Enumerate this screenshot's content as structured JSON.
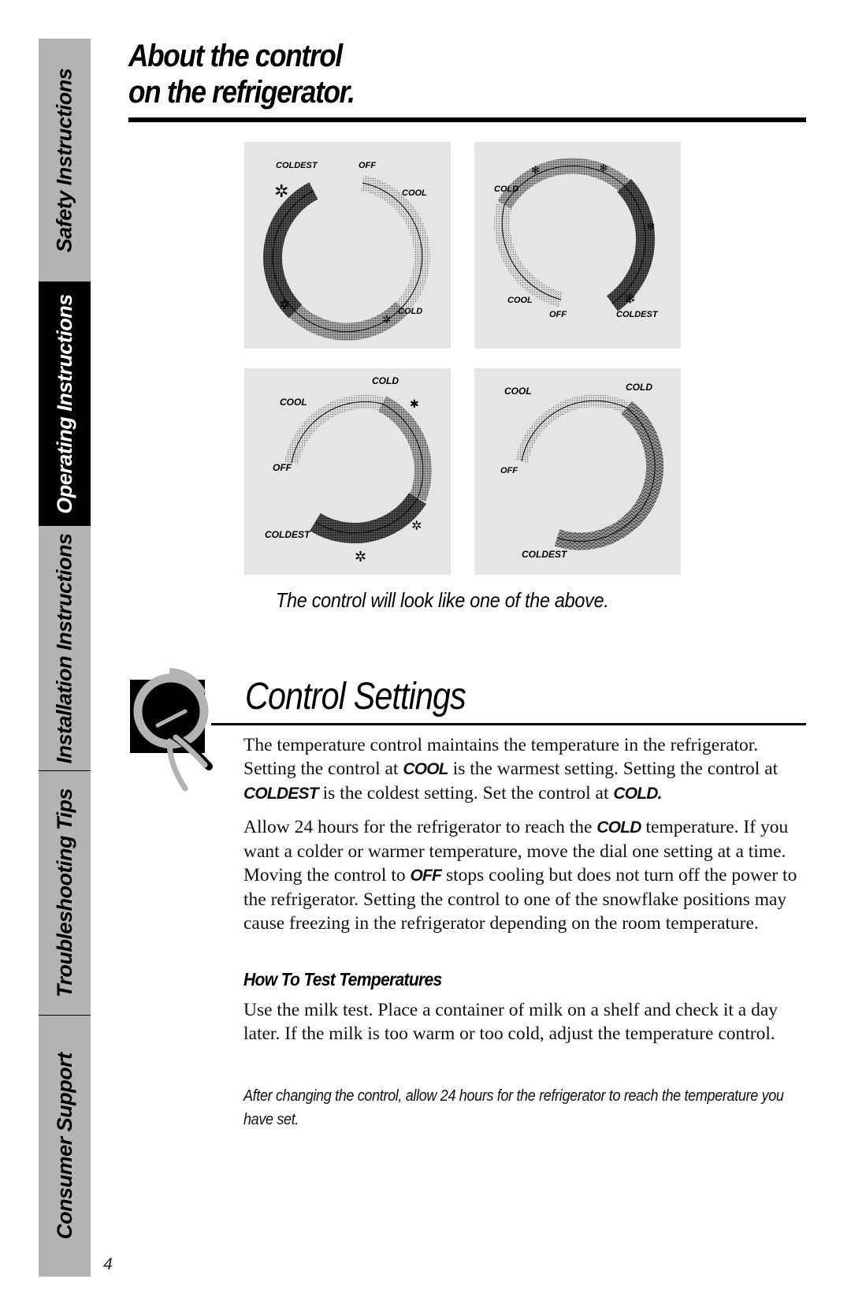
{
  "sidebar": {
    "tabs": [
      {
        "label": "Safety Instructions",
        "active": false
      },
      {
        "label": "Operating Instructions",
        "active": true
      },
      {
        "label": "Installation Instructions",
        "active": false
      },
      {
        "label": "Troubleshooting Tips",
        "active": false
      },
      {
        "label": "Consumer Support",
        "active": false
      }
    ]
  },
  "page_number": "4",
  "header": {
    "title_line1": "About the control",
    "title_line2": "on the refrigerator."
  },
  "dials": [
    {
      "labels": {
        "coldest": "COLDEST",
        "off": "OFF",
        "cool": "COOL",
        "cold": "COLD"
      },
      "icons": [
        "snowflake-icon",
        "snowflake-icon",
        "snowflake-icon"
      ]
    },
    {
      "labels": {
        "cold": "COLD",
        "cool": "COOL",
        "off": "OFF",
        "coldest": "COLDEST"
      },
      "icons": [
        "snowflake-icon",
        "snowflake-icon",
        "snowflake-icon",
        "snowflake-icon"
      ]
    },
    {
      "labels": {
        "cold": "COLD",
        "cool": "COOL",
        "off": "OFF",
        "coldest": "COLDEST"
      },
      "icons": [
        "snowflake-icon",
        "snowflake-icon",
        "snowflake-icon"
      ]
    },
    {
      "labels": {
        "cool": "COOL",
        "cold": "COLD",
        "off": "OFF",
        "coldest": "COLDEST"
      },
      "icons": []
    }
  ],
  "dial_caption": "The control will look like one of the above.",
  "control_settings": {
    "title": "Control Settings",
    "para1": {
      "t1": "The temperature control maintains the temperature in the refrigerator. Setting the control at ",
      "k1": "COOL",
      "t2": " is the warmest setting. Setting the control at ",
      "k2": "COLDEST",
      "t3": " is the coldest setting. Set the control at ",
      "k3": "COLD."
    },
    "para2": {
      "t1": "Allow 24 hours for the refrigerator to reach the ",
      "k1": "COLD",
      "t2": " temperature. If you want a colder or warmer temperature, move the dial one setting at a time. Moving the control to ",
      "k2": "OFF",
      "t3": " stops cooling but does not turn off the power to the refrigerator. Setting the control to one of the snowflake positions may cause freezing in the refrigerator depending on the room temperature."
    },
    "subheading": "How To Test Temperatures",
    "para3": "Use the milk test. Place a container of milk on a shelf and check it a day later. If the milk is too warm or too cold, adjust the temperature control.",
    "note": "After changing the control, allow 24 hours for the refrigerator to reach the temperature you have set."
  }
}
